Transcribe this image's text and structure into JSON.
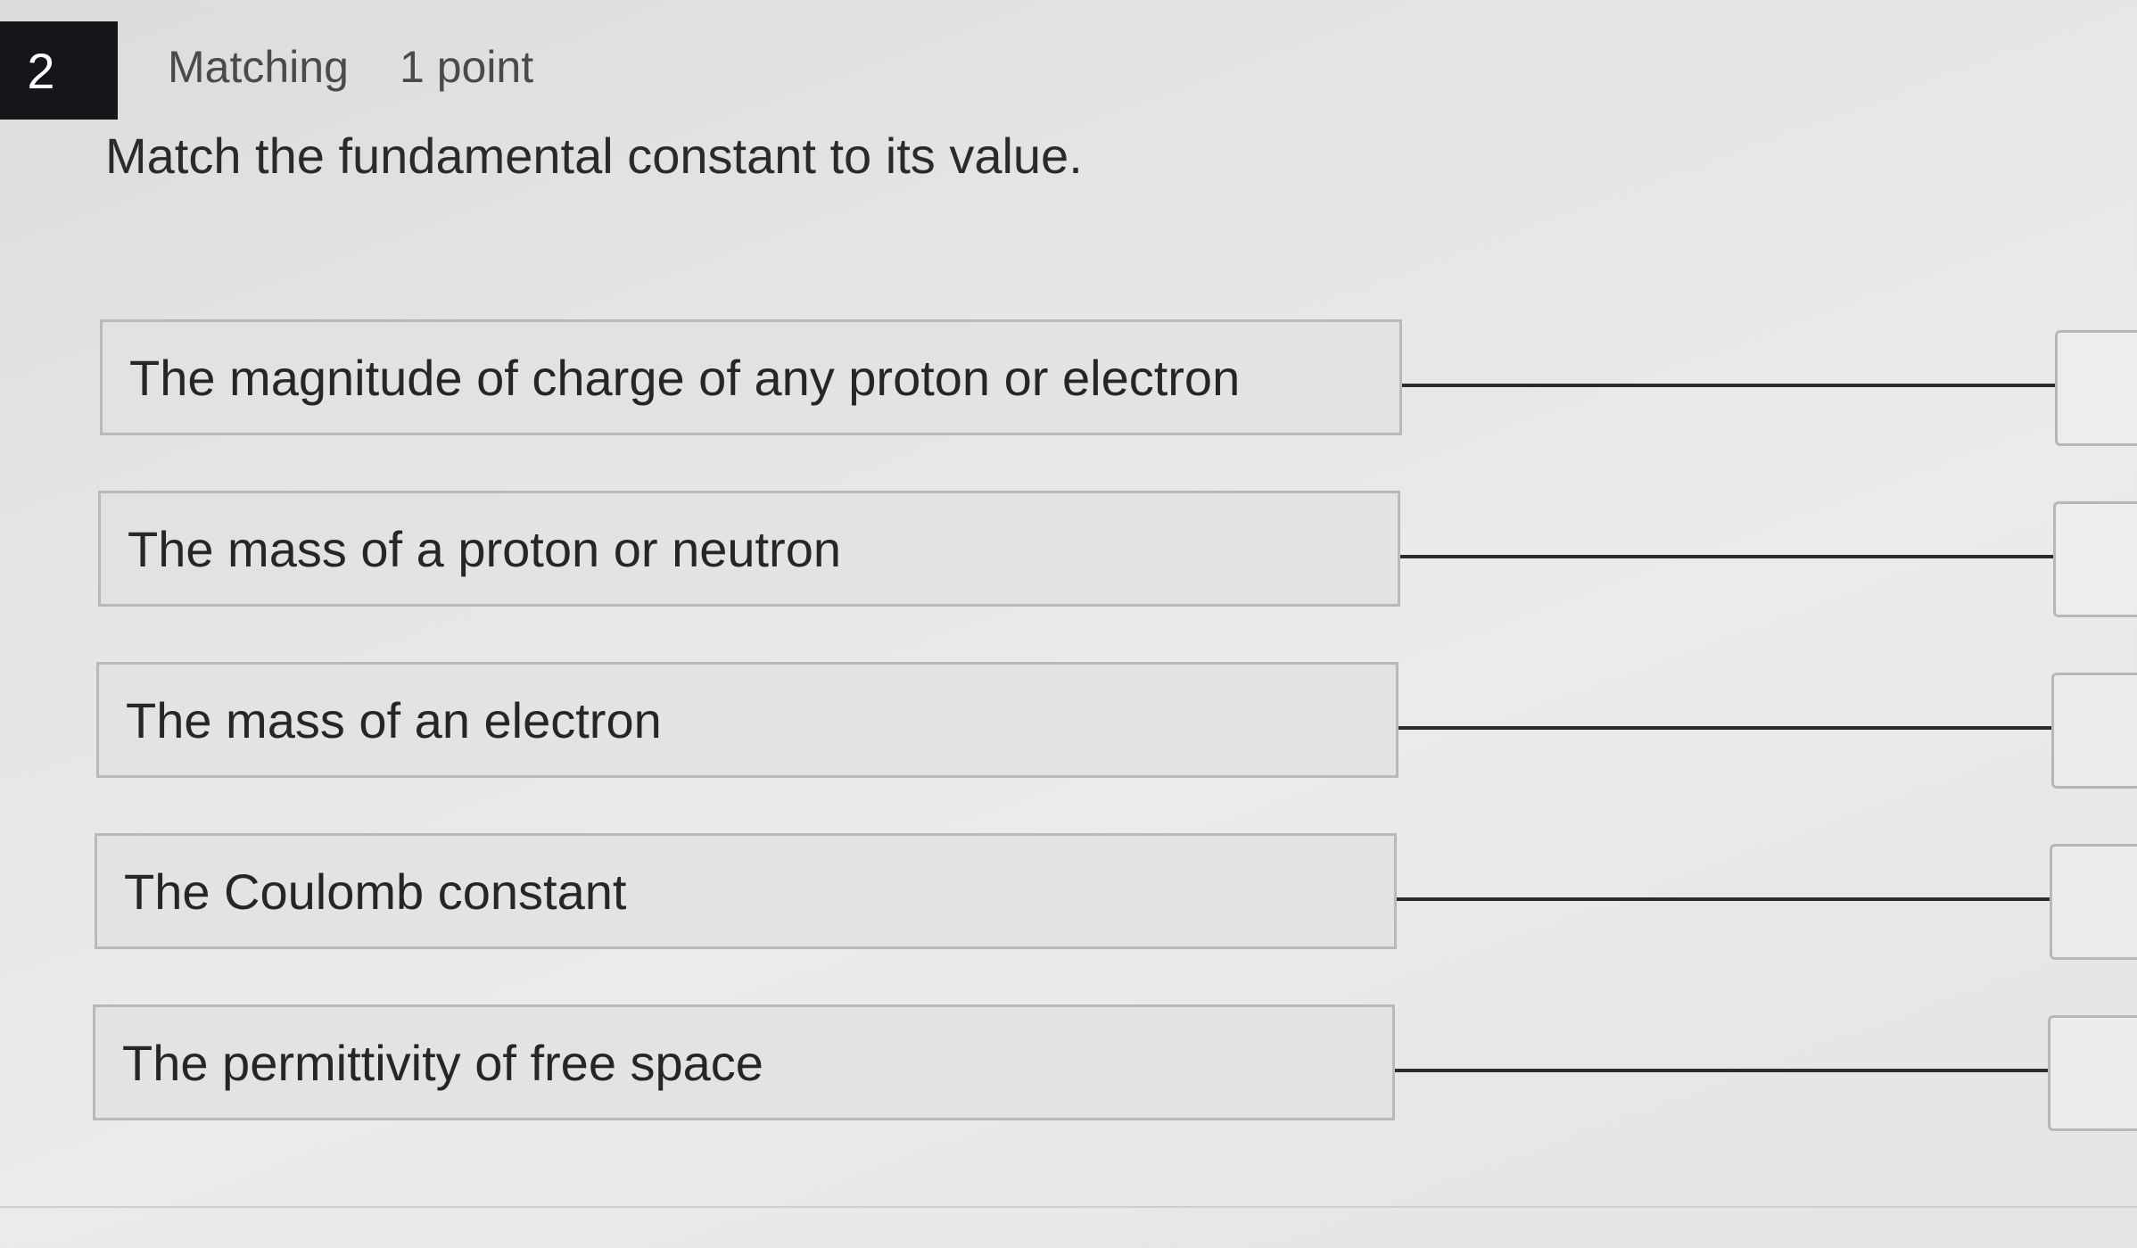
{
  "question": {
    "number": "2",
    "type": "Matching",
    "points": "1 point",
    "prompt": "Match the fundamental constant to its value."
  },
  "items": [
    {
      "term": "The magnitude of charge of any proton or electron"
    },
    {
      "term": "The mass of a proton or neutron"
    },
    {
      "term": "The mass of an electron"
    },
    {
      "term": "The Coulomb constant"
    },
    {
      "term": "The permittivity of free space"
    }
  ]
}
